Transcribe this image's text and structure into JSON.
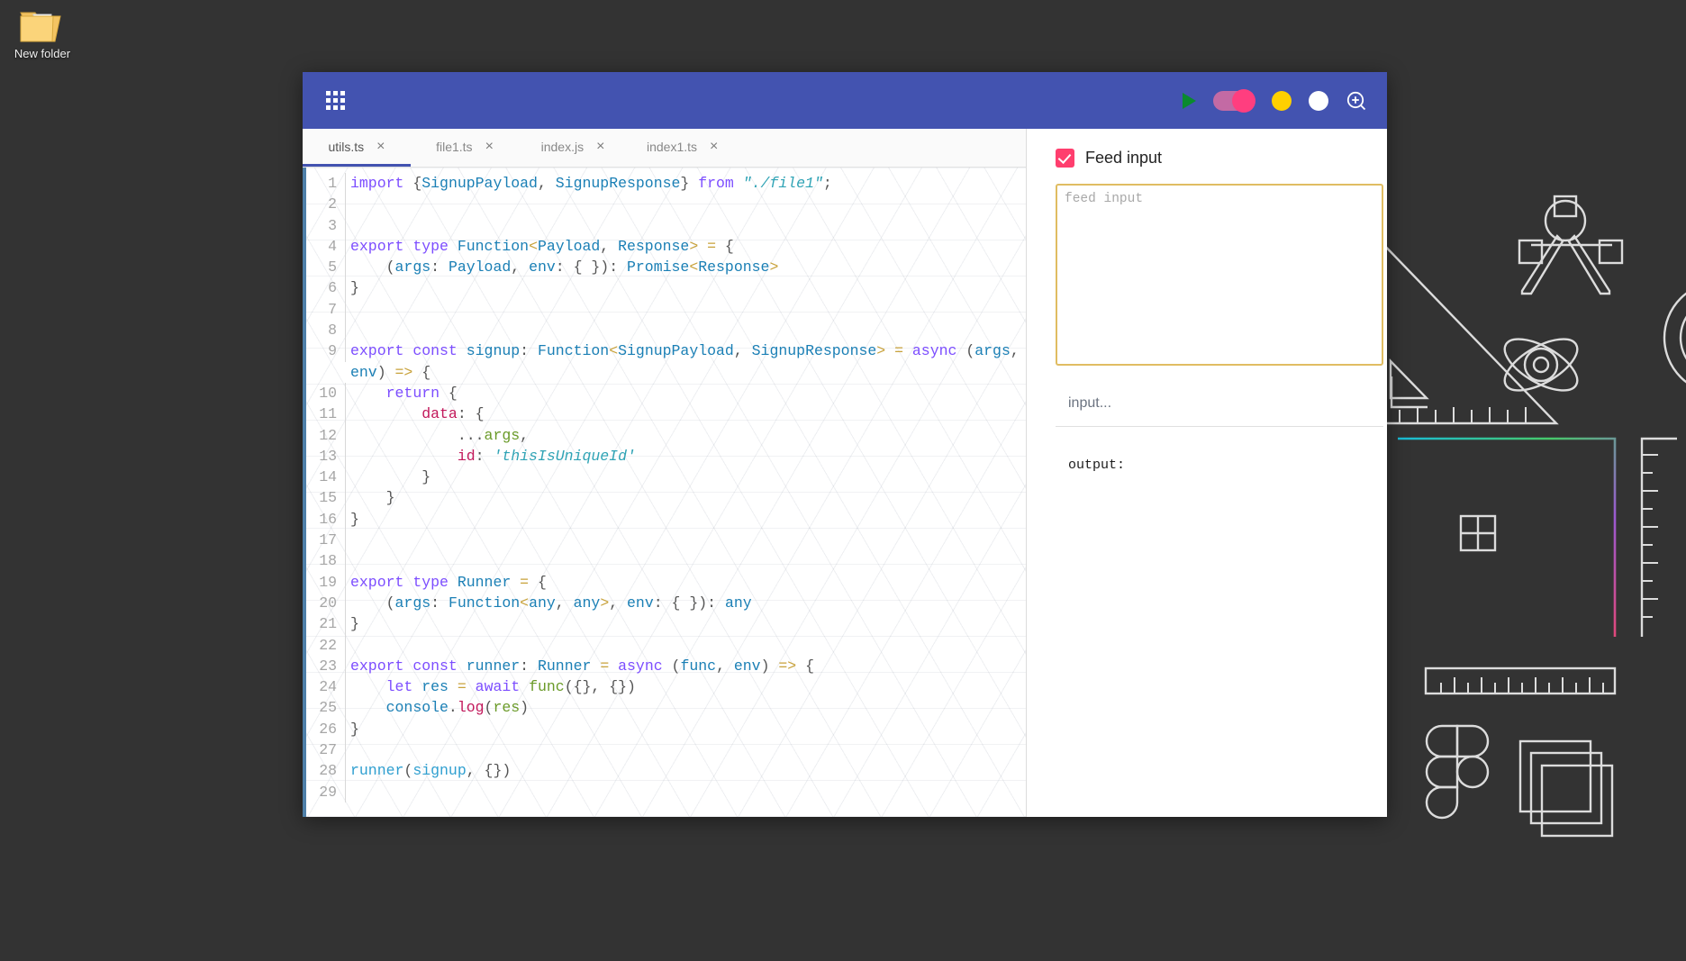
{
  "desktop": {
    "icons": [
      {
        "label": "New folder",
        "icon": "folder-icon"
      }
    ]
  },
  "window": {
    "titlebar": {
      "menu_icon": "apps-grid-icon",
      "actions": [
        {
          "name": "run-button",
          "icon": "play-icon"
        },
        {
          "name": "mode-toggle",
          "icon": "toggle-switch-icon"
        },
        {
          "name": "minimize-button",
          "icon": "yellow-circle-icon"
        },
        {
          "name": "maximize-button",
          "icon": "white-circle-icon"
        },
        {
          "name": "zoom-in-button",
          "icon": "zoom-in-icon"
        }
      ]
    },
    "tabs": [
      {
        "label": "utils.ts",
        "active": true,
        "close": "×"
      },
      {
        "label": "file1.ts",
        "active": false,
        "close": "×"
      },
      {
        "label": "index.js",
        "active": false,
        "close": "×"
      },
      {
        "label": "index1.ts",
        "active": false,
        "close": "×"
      }
    ],
    "editor": {
      "active_file": "utils.ts",
      "total_lines": 29,
      "lines": [
        {
          "n": 1,
          "tokens": [
            {
              "t": "import",
              "c": "k"
            },
            {
              "t": " ",
              "c": "df"
            },
            {
              "t": "{",
              "c": "pl"
            },
            {
              "t": "SignupPayload",
              "c": "kb"
            },
            {
              "t": ", ",
              "c": "pl"
            },
            {
              "t": "SignupResponse",
              "c": "kb"
            },
            {
              "t": "}",
              "c": "pl"
            },
            {
              "t": " ",
              "c": "df"
            },
            {
              "t": "from",
              "c": "k"
            },
            {
              "t": " ",
              "c": "df"
            },
            {
              "t": "\"./file1\"",
              "c": "st"
            },
            {
              "t": ";",
              "c": "pl"
            }
          ]
        },
        {
          "n": 2,
          "tokens": []
        },
        {
          "n": 3,
          "tokens": []
        },
        {
          "n": 4,
          "tokens": [
            {
              "t": "export",
              "c": "k"
            },
            {
              "t": " ",
              "c": "df"
            },
            {
              "t": "type",
              "c": "k"
            },
            {
              "t": " ",
              "c": "df"
            },
            {
              "t": "Function",
              "c": "kb"
            },
            {
              "t": "<",
              "c": "br"
            },
            {
              "t": "Payload",
              "c": "kb"
            },
            {
              "t": ", ",
              "c": "pl"
            },
            {
              "t": "Response",
              "c": "kb"
            },
            {
              "t": ">",
              "c": "br"
            },
            {
              "t": " ",
              "c": "df"
            },
            {
              "t": "=",
              "c": "op"
            },
            {
              "t": " {",
              "c": "pl"
            }
          ]
        },
        {
          "n": 5,
          "tokens": [
            {
              "t": "    (",
              "c": "pl"
            },
            {
              "t": "args",
              "c": "kb"
            },
            {
              "t": ": ",
              "c": "pl"
            },
            {
              "t": "Payload",
              "c": "kb"
            },
            {
              "t": ", ",
              "c": "pl"
            },
            {
              "t": "env",
              "c": "kb"
            },
            {
              "t": ": { }): ",
              "c": "pl"
            },
            {
              "t": "Promise",
              "c": "kb"
            },
            {
              "t": "<",
              "c": "br"
            },
            {
              "t": "Response",
              "c": "kb"
            },
            {
              "t": ">",
              "c": "br"
            }
          ]
        },
        {
          "n": 6,
          "tokens": [
            {
              "t": "}",
              "c": "pl"
            }
          ]
        },
        {
          "n": 7,
          "tokens": []
        },
        {
          "n": 8,
          "tokens": []
        },
        {
          "n": 9,
          "tokens": [
            {
              "t": "export",
              "c": "k"
            },
            {
              "t": " ",
              "c": "df"
            },
            {
              "t": "const",
              "c": "k"
            },
            {
              "t": " ",
              "c": "df"
            },
            {
              "t": "signup",
              "c": "kb"
            },
            {
              "t": ": ",
              "c": "pl"
            },
            {
              "t": "Function",
              "c": "kb"
            },
            {
              "t": "<",
              "c": "br"
            },
            {
              "t": "SignupPayload",
              "c": "kb"
            },
            {
              "t": ", ",
              "c": "pl"
            },
            {
              "t": "SignupResponse",
              "c": "kb"
            },
            {
              "t": ">",
              "c": "br"
            },
            {
              "t": " ",
              "c": "df"
            },
            {
              "t": "=",
              "c": "op"
            },
            {
              "t": " ",
              "c": "df"
            },
            {
              "t": "async",
              "c": "k"
            },
            {
              "t": " (",
              "c": "pl"
            },
            {
              "t": "args",
              "c": "kb"
            },
            {
              "t": ", ",
              "c": "pl"
            },
            {
              "t": "env",
              "c": "kb"
            },
            {
              "t": ") ",
              "c": "pl"
            },
            {
              "t": "=>",
              "c": "op"
            },
            {
              "t": " {",
              "c": "pl"
            }
          ]
        },
        {
          "n": 10,
          "tokens": [
            {
              "t": "    ",
              "c": "df"
            },
            {
              "t": "return",
              "c": "k"
            },
            {
              "t": " {",
              "c": "pl"
            }
          ]
        },
        {
          "n": 11,
          "tokens": [
            {
              "t": "        ",
              "c": "df"
            },
            {
              "t": "data",
              "c": "pn"
            },
            {
              "t": ": {",
              "c": "pl"
            }
          ]
        },
        {
          "n": 12,
          "tokens": [
            {
              "t": "            ...",
              "c": "pl"
            },
            {
              "t": "args",
              "c": "gn"
            },
            {
              "t": ",",
              "c": "pl"
            }
          ]
        },
        {
          "n": 13,
          "tokens": [
            {
              "t": "            ",
              "c": "df"
            },
            {
              "t": "id",
              "c": "pn"
            },
            {
              "t": ": ",
              "c": "pl"
            },
            {
              "t": "'thisIsUniqueId'",
              "c": "st"
            }
          ]
        },
        {
          "n": 14,
          "tokens": [
            {
              "t": "        }",
              "c": "pl"
            }
          ]
        },
        {
          "n": 15,
          "tokens": [
            {
              "t": "    }",
              "c": "pl"
            }
          ]
        },
        {
          "n": 16,
          "tokens": [
            {
              "t": "}",
              "c": "pl"
            }
          ]
        },
        {
          "n": 17,
          "tokens": []
        },
        {
          "n": 18,
          "tokens": []
        },
        {
          "n": 19,
          "tokens": [
            {
              "t": "export",
              "c": "k"
            },
            {
              "t": " ",
              "c": "df"
            },
            {
              "t": "type",
              "c": "k"
            },
            {
              "t": " ",
              "c": "df"
            },
            {
              "t": "Runner",
              "c": "kb"
            },
            {
              "t": " ",
              "c": "df"
            },
            {
              "t": "=",
              "c": "op"
            },
            {
              "t": " {",
              "c": "pl"
            }
          ]
        },
        {
          "n": 20,
          "tokens": [
            {
              "t": "    (",
              "c": "pl"
            },
            {
              "t": "args",
              "c": "kb"
            },
            {
              "t": ": ",
              "c": "pl"
            },
            {
              "t": "Function",
              "c": "kb"
            },
            {
              "t": "<",
              "c": "br"
            },
            {
              "t": "any",
              "c": "kb"
            },
            {
              "t": ", ",
              "c": "pl"
            },
            {
              "t": "any",
              "c": "kb"
            },
            {
              "t": ">",
              "c": "br"
            },
            {
              "t": ", ",
              "c": "pl"
            },
            {
              "t": "env",
              "c": "kb"
            },
            {
              "t": ": { }): ",
              "c": "pl"
            },
            {
              "t": "any",
              "c": "kb"
            }
          ]
        },
        {
          "n": 21,
          "tokens": [
            {
              "t": "}",
              "c": "pl"
            }
          ]
        },
        {
          "n": 22,
          "tokens": []
        },
        {
          "n": 23,
          "tokens": [
            {
              "t": "export",
              "c": "k"
            },
            {
              "t": " ",
              "c": "df"
            },
            {
              "t": "const",
              "c": "k"
            },
            {
              "t": " ",
              "c": "df"
            },
            {
              "t": "runner",
              "c": "kb"
            },
            {
              "t": ": ",
              "c": "pl"
            },
            {
              "t": "Runner",
              "c": "kb"
            },
            {
              "t": " ",
              "c": "df"
            },
            {
              "t": "=",
              "c": "op"
            },
            {
              "t": " ",
              "c": "df"
            },
            {
              "t": "async",
              "c": "k"
            },
            {
              "t": " (",
              "c": "pl"
            },
            {
              "t": "func",
              "c": "kb"
            },
            {
              "t": ", ",
              "c": "pl"
            },
            {
              "t": "env",
              "c": "kb"
            },
            {
              "t": ") ",
              "c": "pl"
            },
            {
              "t": "=>",
              "c": "op"
            },
            {
              "t": " {",
              "c": "pl"
            }
          ]
        },
        {
          "n": 24,
          "tokens": [
            {
              "t": "    ",
              "c": "df"
            },
            {
              "t": "let",
              "c": "k"
            },
            {
              "t": " ",
              "c": "df"
            },
            {
              "t": "res",
              "c": "kb"
            },
            {
              "t": " ",
              "c": "df"
            },
            {
              "t": "=",
              "c": "op"
            },
            {
              "t": " ",
              "c": "df"
            },
            {
              "t": "await",
              "c": "k"
            },
            {
              "t": " ",
              "c": "df"
            },
            {
              "t": "func",
              "c": "gn"
            },
            {
              "t": "({}, {})",
              "c": "pl"
            }
          ]
        },
        {
          "n": 25,
          "tokens": [
            {
              "t": "    ",
              "c": "df"
            },
            {
              "t": "console",
              "c": "kb"
            },
            {
              "t": ".",
              "c": "pl"
            },
            {
              "t": "log",
              "c": "pn"
            },
            {
              "t": "(",
              "c": "pl"
            },
            {
              "t": "res",
              "c": "gn"
            },
            {
              "t": ")",
              "c": "pl"
            }
          ]
        },
        {
          "n": 26,
          "tokens": [
            {
              "t": "}",
              "c": "pl"
            }
          ]
        },
        {
          "n": 27,
          "tokens": []
        },
        {
          "n": 28,
          "tokens": [
            {
              "t": "runner",
              "c": "id"
            },
            {
              "t": "(",
              "c": "pl"
            },
            {
              "t": "signup",
              "c": "id"
            },
            {
              "t": ", {})",
              "c": "pl"
            }
          ]
        },
        {
          "n": 29,
          "tokens": []
        }
      ]
    },
    "panel": {
      "feed_input_label": "Feed input",
      "feed_input_checked": true,
      "feed_textarea_value": "",
      "feed_textarea_placeholder": "feed input",
      "input_label": "input...",
      "output_label": "output:"
    }
  },
  "colors": {
    "titlebar": "#4353b0",
    "accent_pink": "#ff3e6e",
    "toggle_track": "#c36aa4",
    "toggle_knob": "#ff3e7f",
    "yellow_dot": "#ffd000",
    "white_dot": "#ffffff",
    "play_green": "#0a8a2e",
    "textarea_border": "#e0bd62",
    "desktop_bg": "#333333",
    "active_tab_underline": "#4353b0"
  }
}
